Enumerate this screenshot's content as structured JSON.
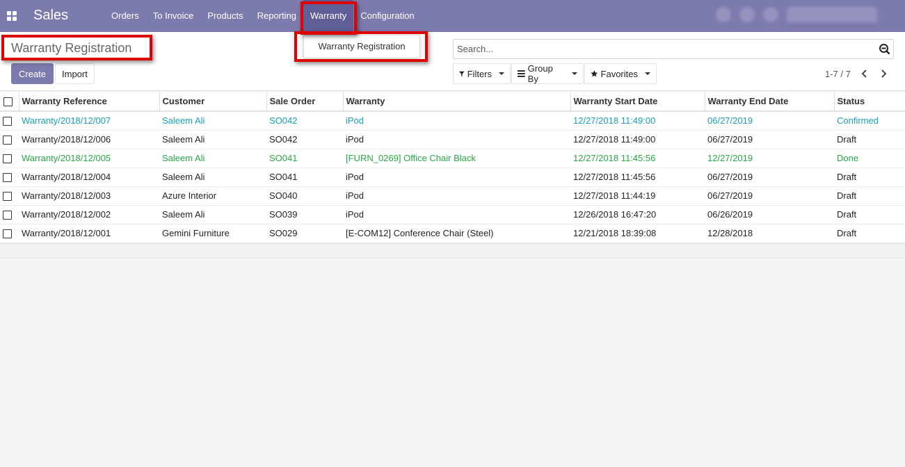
{
  "navbar": {
    "brand": "Sales",
    "menu": [
      {
        "label": "Orders"
      },
      {
        "label": "To Invoice"
      },
      {
        "label": "Products"
      },
      {
        "label": "Reporting"
      },
      {
        "label": "Warranty"
      },
      {
        "label": "Configuration"
      }
    ]
  },
  "control_panel": {
    "breadcrumb": "Warranty Registration",
    "create_label": "Create",
    "import_label": "Import",
    "dropdown_item": "Warranty Registration",
    "search_placeholder": "Search...",
    "filters_label": "Filters",
    "groupby_label": "Group By",
    "favorites_label": "Favorites",
    "pager": "1-7 / 7"
  },
  "table": {
    "columns": [
      "Warranty Reference",
      "Customer",
      "Sale Order",
      "Warranty",
      "Warranty Start Date",
      "Warranty End Date",
      "Status"
    ],
    "rows": [
      [
        "Warranty/2018/12/007",
        "Saleem Ali",
        "SO042",
        "iPod",
        "12/27/2018 11:49:00",
        "06/27/2019",
        "Confirmed"
      ],
      [
        "Warranty/2018/12/006",
        "Saleem Ali",
        "SO042",
        "iPod",
        "12/27/2018 11:49:00",
        "06/27/2019",
        "Draft"
      ],
      [
        "Warranty/2018/12/005",
        "Saleem Ali",
        "SO041",
        "[FURN_0269] Office Chair Black",
        "12/27/2018 11:45:56",
        "12/27/2019",
        "Done"
      ],
      [
        "Warranty/2018/12/004",
        "Saleem Ali",
        "SO041",
        "iPod",
        "12/27/2018 11:45:56",
        "06/27/2019",
        "Draft"
      ],
      [
        "Warranty/2018/12/003",
        "Azure Interior",
        "SO040",
        "iPod",
        "12/27/2018 11:44:19",
        "06/27/2019",
        "Draft"
      ],
      [
        "Warranty/2018/12/002",
        "Saleem Ali",
        "SO039",
        "iPod",
        "12/26/2018 16:47:20",
        "06/26/2019",
        "Draft"
      ],
      [
        "Warranty/2018/12/001",
        "Gemini Furniture",
        "SO029",
        "[E-COM12] Conference Chair (Steel)",
        "12/21/2018 18:39:08",
        "12/28/2018",
        "Draft"
      ]
    ]
  },
  "colors": {
    "navbar": "#7c7bad",
    "confirmed": "#17a2b8",
    "done": "#28a745",
    "annotation": "#e00000"
  }
}
